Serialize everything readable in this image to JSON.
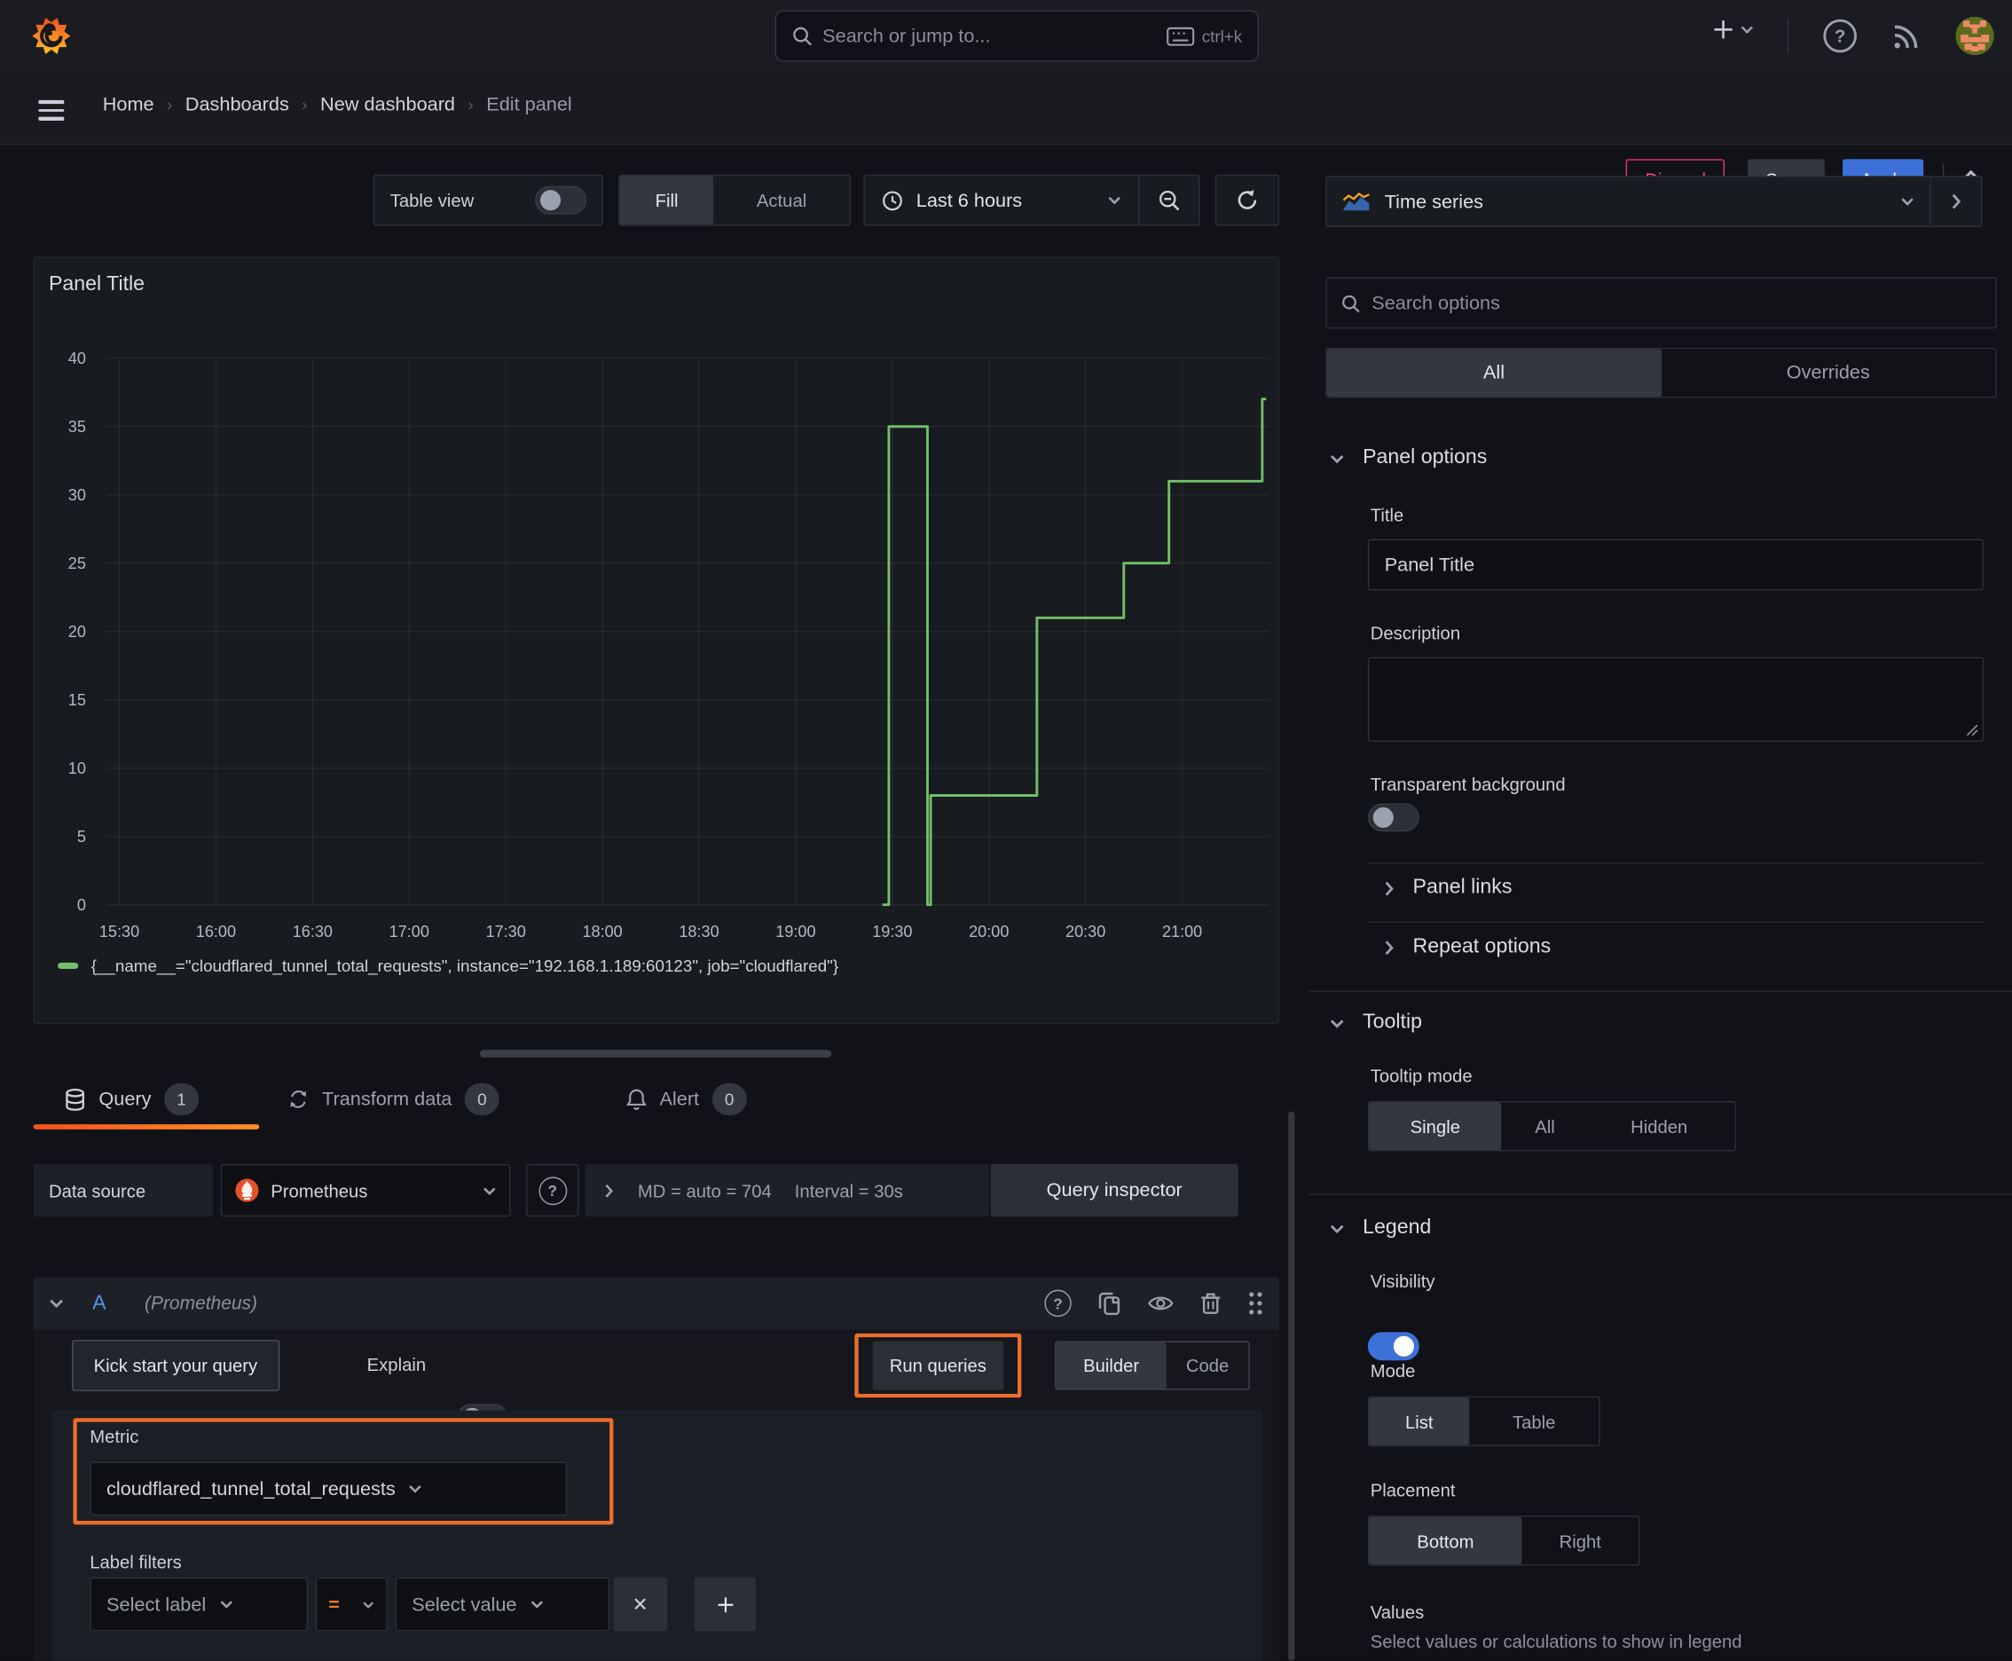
{
  "topbar": {
    "search_placeholder": "Search or jump to...",
    "shortcut_hint": "ctrl+k"
  },
  "breadcrumb": {
    "items": [
      "Home",
      "Dashboards",
      "New dashboard",
      "Edit panel"
    ]
  },
  "actions": {
    "discard": "Discard",
    "save": "Save",
    "apply": "Apply"
  },
  "toolbar": {
    "table_view_label": "Table view",
    "fill_label": "Fill",
    "actual_label": "Actual",
    "time_range_label": "Last 6 hours"
  },
  "panel": {
    "title": "Panel Title"
  },
  "chart_data": {
    "type": "line",
    "line_style": "step-after",
    "title": "Panel Title",
    "xlabel": "",
    "ylabel": "",
    "ylim": [
      0,
      40
    ],
    "y_ticks": [
      0,
      5,
      10,
      15,
      20,
      25,
      30,
      35,
      40
    ],
    "x_ticks": [
      "15:30",
      "16:00",
      "16:30",
      "17:00",
      "17:30",
      "18:00",
      "18:30",
      "19:00",
      "19:30",
      "20:00",
      "20:30",
      "21:00"
    ],
    "grid": true,
    "legend_position": "bottom",
    "series": [
      {
        "name": "{__name__=\"cloudflared_tunnel_total_requests\", instance=\"192.168.1.189:60123\", job=\"cloudflared\"}",
        "color": "#73BF69",
        "points": [
          {
            "time": "19:27",
            "value": 0
          },
          {
            "time": "19:29",
            "value": 35
          },
          {
            "time": "19:41",
            "value": 0
          },
          {
            "time": "19:42",
            "value": 8
          },
          {
            "time": "20:15",
            "value": 21
          },
          {
            "time": "20:42",
            "value": 25
          },
          {
            "time": "20:56",
            "value": 31
          },
          {
            "time": "21:25",
            "value": 37
          }
        ]
      }
    ]
  },
  "query_tabs": {
    "query": "Query",
    "query_count": "1",
    "transform": "Transform data",
    "transform_count": "0",
    "alert": "Alert",
    "alert_count": "0"
  },
  "query_editor": {
    "datasource_label": "Data source",
    "datasource_name": "Prometheus",
    "stats_md": "MD = auto = 704",
    "stats_interval": "Interval = 30s",
    "inspector_label": "Query inspector",
    "row_id": "A",
    "row_datasource": "(Prometheus)",
    "kickstart_label": "Kick start your query",
    "explain_label": "Explain",
    "run_label": "Run queries",
    "builder_label": "Builder",
    "code_label": "Code",
    "metric_label": "Metric",
    "metric_value": "cloudflared_tunnel_total_requests",
    "label_filters_label": "Label filters",
    "select_label_placeholder": "Select label",
    "operator": "=",
    "select_value_placeholder": "Select value"
  },
  "viz_picker": {
    "current": "Time series"
  },
  "options_pane": {
    "search_placeholder": "Search options",
    "tabs": {
      "all": "All",
      "overrides": "Overrides"
    },
    "panel_options": {
      "header": "Panel options",
      "title_label": "Title",
      "title_value": "Panel Title",
      "description_label": "Description",
      "transparent_label": "Transparent background",
      "panel_links": "Panel links",
      "repeat_options": "Repeat options"
    },
    "tooltip": {
      "header": "Tooltip",
      "mode_label": "Tooltip mode",
      "modes": [
        "Single",
        "All",
        "Hidden"
      ],
      "selected_mode": "Single"
    },
    "legend": {
      "header": "Legend",
      "visibility_label": "Visibility",
      "mode_label": "Mode",
      "modes": [
        "List",
        "Table"
      ],
      "selected_mode": "List",
      "placement_label": "Placement",
      "placements": [
        "Bottom",
        "Right"
      ],
      "selected_placement": "Bottom",
      "values_label": "Values",
      "values_description": "Select values or calculations to show in legend"
    }
  },
  "colors": {
    "background": "#111217",
    "panel": "#181b1f",
    "accent_orange": "#ff780a",
    "annotation_orange": "#ec6d2d",
    "series_green": "#73BF69",
    "primary_blue": "#3d71d9",
    "discard_red": "#e8356d"
  }
}
